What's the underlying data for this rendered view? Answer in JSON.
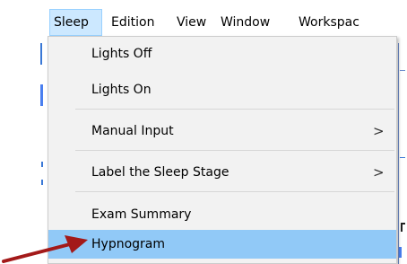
{
  "menubar": {
    "items": [
      "Sleep",
      "Edition",
      "View",
      "Window",
      "Workspac"
    ],
    "active_index": 0
  },
  "sleep_menu": {
    "items": [
      {
        "label": "Lights Off",
        "submenu": false
      },
      {
        "label": "Lights On",
        "submenu": false
      },
      {
        "label": "Manual Input",
        "submenu": true
      },
      {
        "label": "Label the Sleep Stage",
        "submenu": true
      },
      {
        "label": "Exam Summary",
        "submenu": false
      },
      {
        "label": "Hypnogram",
        "submenu": false
      }
    ],
    "highlighted_index": 5,
    "submenu_indicator": ">"
  },
  "annotation": {
    "arrow_color": "#a31919",
    "points_to": "Hypnogram"
  },
  "colors": {
    "menu_background": "#f2f2f2",
    "highlight": "#91c9f7",
    "active_menubar": "#cce8ff"
  }
}
